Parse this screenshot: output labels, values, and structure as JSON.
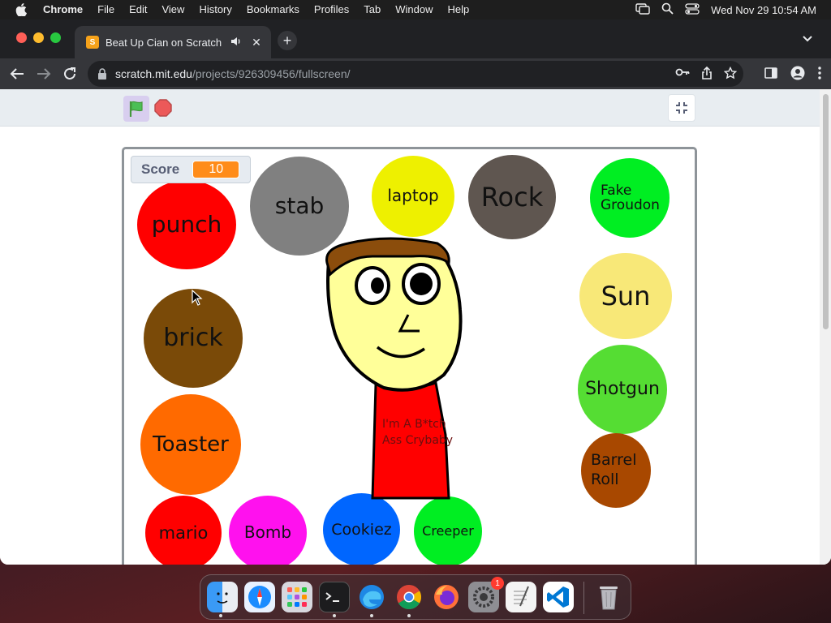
{
  "menubar": {
    "app_name": "Chrome",
    "items": [
      "File",
      "Edit",
      "View",
      "History",
      "Bookmarks",
      "Profiles",
      "Tab",
      "Window",
      "Help"
    ],
    "clock": "Wed Nov 29  10:54 AM"
  },
  "browser": {
    "tab_title": "Beat Up Cian on Scratch",
    "url_host": "scratch.mit.edu",
    "url_path": "/projects/926309456/fullscreen/"
  },
  "stage": {
    "monitor_label": "Score",
    "monitor_value": "10",
    "shirt_text": "I'm A B*tch Ass Crybaby",
    "sprites": [
      {
        "label": "punch",
        "color": "#ff0000"
      },
      {
        "label": "stab",
        "color": "#808080"
      },
      {
        "label": "laptop",
        "color": "#eef000"
      },
      {
        "label": "Rock",
        "color": "#5f5650"
      },
      {
        "label": "Fake Groudon",
        "color": "#00ee22"
      },
      {
        "label": "Sun",
        "color": "#f8e878"
      },
      {
        "label": "brick",
        "color": "#7a4a08"
      },
      {
        "label": "Shotgun",
        "color": "#55dd33"
      },
      {
        "label": "Toaster",
        "color": "#ff6a00"
      },
      {
        "label": "Barrel Roll",
        "color": "#a84800"
      },
      {
        "label": "mario",
        "color": "#ff0000"
      },
      {
        "label": "Bomb",
        "color": "#ff11ee"
      },
      {
        "label": "Cookiez",
        "color": "#0066ff"
      },
      {
        "label": "Creeper",
        "color": "#00ee22"
      }
    ]
  },
  "dock": {
    "apps": [
      "Finder",
      "Safari",
      "Launchpad",
      "Terminal",
      "Microsoft Edge",
      "Google Chrome",
      "Firefox",
      "System Settings",
      "TextEdit",
      "Visual Studio Code",
      "Trash"
    ],
    "settings_badge": "1"
  }
}
